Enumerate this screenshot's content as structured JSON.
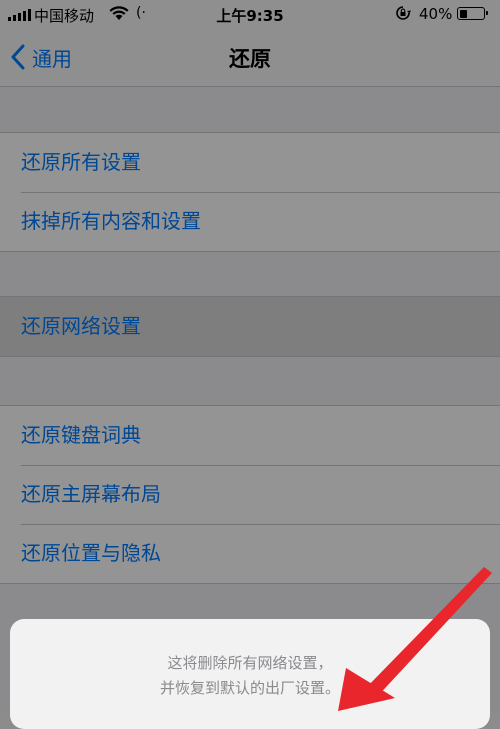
{
  "status_bar": {
    "carrier": "中国移动",
    "hotspot_glyph": "(·",
    "time": "上午9:35",
    "battery_pct": "40%",
    "battery_level": 0.4
  },
  "nav": {
    "back_label": "通用",
    "title": "还原"
  },
  "groups": {
    "first": [
      "还原所有设置",
      "抹掉所有内容和设置"
    ],
    "network": "还原网络设置",
    "second": [
      "还原键盘词典",
      "还原主屏幕布局",
      "还原位置与隐私"
    ]
  },
  "sheet": {
    "line1": "这将删除所有网络设置，",
    "line2": "并恢复到默认的出厂设置。"
  },
  "colors": {
    "accent": "#007aff",
    "annotation_arrow": "#e8262b"
  },
  "icons": [
    "signal-icon",
    "wifi-icon",
    "hotspot-icon",
    "rotation-lock-icon",
    "battery-icon",
    "chevron-left-icon"
  ]
}
